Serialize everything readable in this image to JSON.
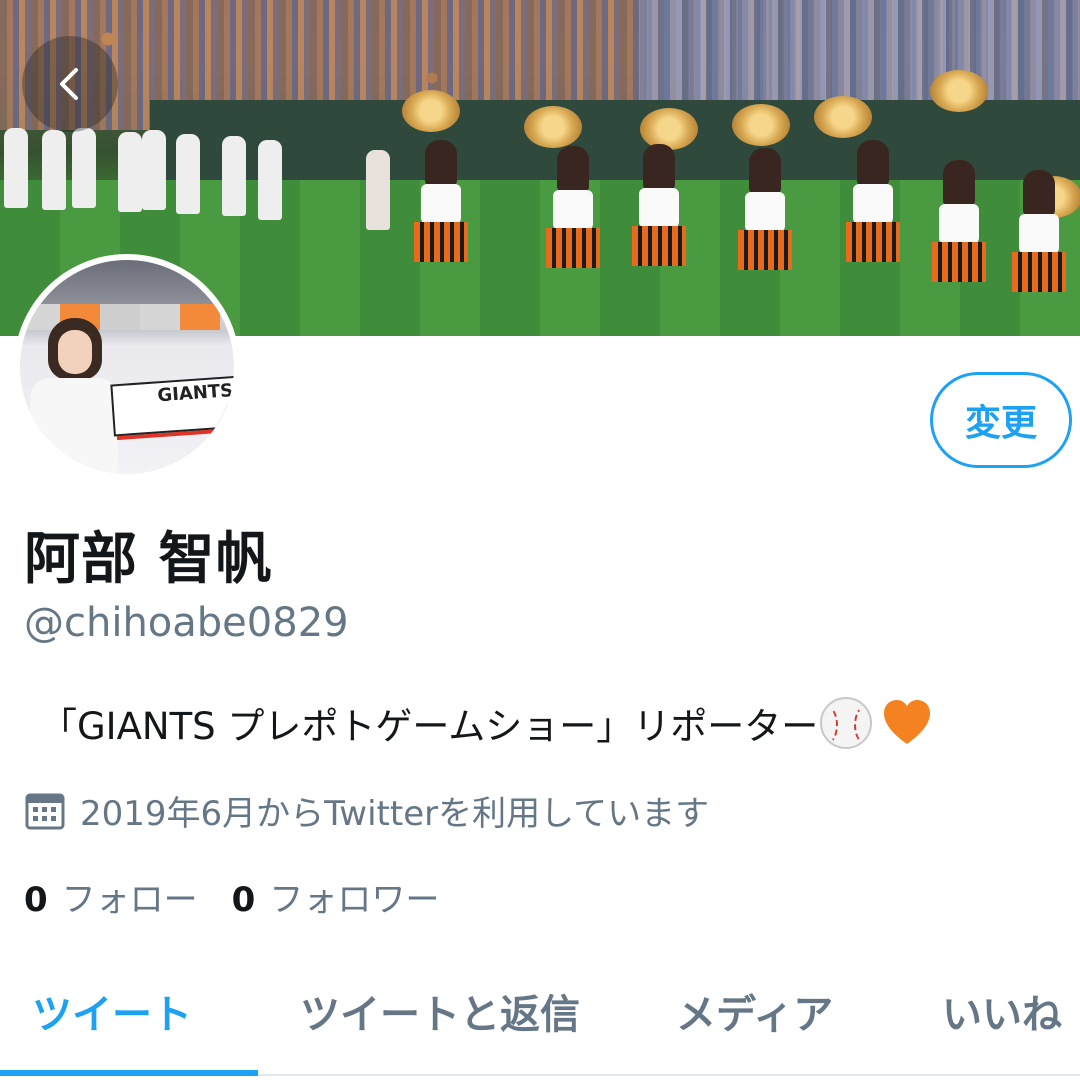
{
  "profile": {
    "name": "阿部 智帆",
    "handle": "@chihoabe0829",
    "bio": "「GIANTS プレポトゲームショー」リポーター",
    "bio_emojis": [
      "baseball-icon",
      "orange-heart-icon"
    ],
    "joined": "2019年6月からTwitterを利用しています",
    "avatar_logo_text": "GIANTS"
  },
  "actions": {
    "edit_label": "変更",
    "back_icon": "chevron-left-icon"
  },
  "stats": {
    "following_count": "0",
    "following_label": "フォロー",
    "followers_count": "0",
    "followers_label": "フォロワー"
  },
  "tabs": [
    {
      "label": "ツイート",
      "active": true
    },
    {
      "label": "ツイートと返信",
      "active": false
    },
    {
      "label": "メディア",
      "active": false
    },
    {
      "label": "いいね",
      "active": false
    }
  ],
  "colors": {
    "accent": "#1da1f2",
    "secondary_text": "#657786",
    "primary_text": "#14171a",
    "heart": "#f58220"
  }
}
